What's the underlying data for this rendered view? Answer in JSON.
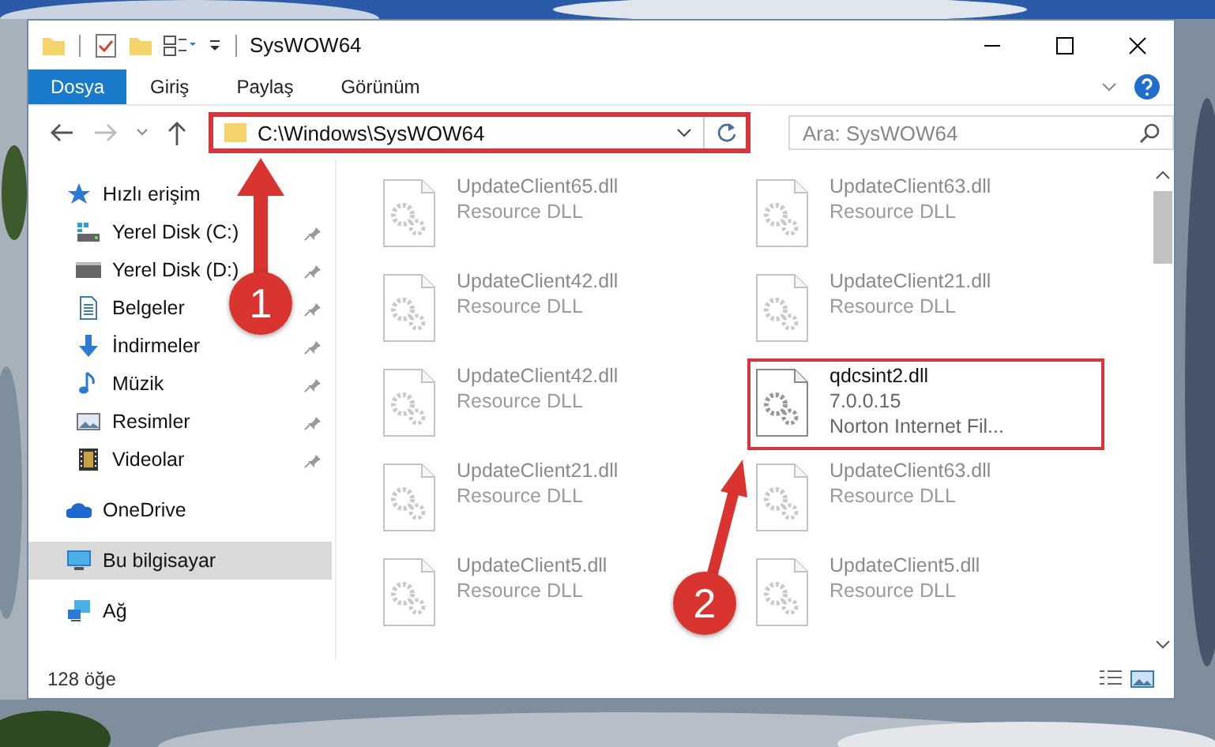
{
  "window": {
    "title": "SysWOW64"
  },
  "ribbon_tabs": [
    {
      "label": "Dosya",
      "selected": true
    },
    {
      "label": "Giriş",
      "selected": false
    },
    {
      "label": "Paylaş",
      "selected": false
    },
    {
      "label": "Görünüm",
      "selected": false
    }
  ],
  "address_bar": {
    "path": "C:\\Windows\\SysWOW64",
    "highlighted": true
  },
  "search": {
    "placeholder": "Ara: SysWOW64"
  },
  "nav_pane": {
    "items": [
      {
        "label": "Hızlı erişim",
        "kind": "star",
        "selected": false,
        "children": [
          {
            "label": "Yerel Disk (C:)",
            "kind": "system-drive",
            "selected": false,
            "pinned": true
          },
          {
            "label": "Yerel Disk (D:)",
            "kind": "drive",
            "selected": false,
            "pinned": true
          },
          {
            "label": "Belgeler",
            "kind": "document",
            "selected": false,
            "pinned": true
          },
          {
            "label": "İndirmeler",
            "kind": "download",
            "selected": false,
            "pinned": true
          },
          {
            "label": "Müzik",
            "kind": "music",
            "selected": false,
            "pinned": true
          },
          {
            "label": "Resimler",
            "kind": "pictures",
            "selected": false,
            "pinned": true
          },
          {
            "label": "Videolar",
            "kind": "video",
            "selected": false,
            "pinned": true
          }
        ]
      },
      {
        "label": "OneDrive",
        "kind": "cloud",
        "selected": false
      },
      {
        "label": "Bu bilgisayar",
        "kind": "computer",
        "selected": true
      },
      {
        "label": "Ağ",
        "kind": "network",
        "selected": false
      }
    ]
  },
  "files": [
    {
      "name": "UpdateClient65.dll",
      "line_2": "Resource DLL",
      "faded": true,
      "highlighted": false
    },
    {
      "name": "UpdateClient63.dll",
      "line_2": "Resource DLL",
      "faded": true,
      "highlighted": false
    },
    {
      "name": "UpdateClient42.dll",
      "line_2": "Resource DLL",
      "faded": true,
      "highlighted": false
    },
    {
      "name": "UpdateClient21.dll",
      "line_2": "Resource DLL",
      "faded": true,
      "highlighted": false
    },
    {
      "name": "UpdateClient42.dll",
      "line_2": "Resource DLL",
      "faded": true,
      "highlighted": false
    },
    {
      "name": "qdcsint2.dll",
      "line_2": "7.0.0.15",
      "line_3": "Norton Internet Fil...",
      "faded": false,
      "highlighted": true
    },
    {
      "name": "UpdateClient21.dll",
      "line_2": "Resource DLL",
      "faded": true,
      "highlighted": false
    },
    {
      "name": "UpdateClient63.dll",
      "line_2": "Resource DLL",
      "faded": true,
      "highlighted": false
    },
    {
      "name": "UpdateClient5.dll",
      "line_2": "Resource DLL",
      "faded": true,
      "highlighted": false
    },
    {
      "name": "UpdateClient5.dll",
      "line_2": "Resource DLL",
      "faded": true,
      "highlighted": false
    }
  ],
  "status_bar": {
    "item_count": "128 öğe"
  },
  "callouts": [
    {
      "number": "1"
    },
    {
      "number": "2"
    }
  ]
}
